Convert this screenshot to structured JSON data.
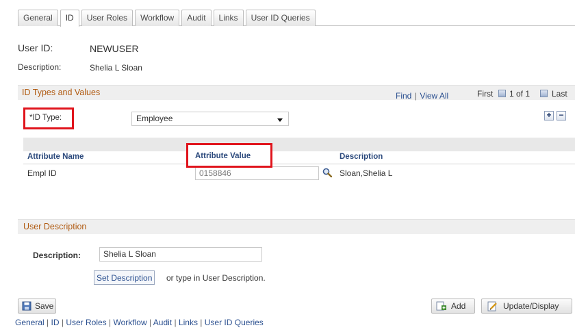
{
  "tabs": [
    {
      "label": "General"
    },
    {
      "label": "ID"
    },
    {
      "label": "User Roles"
    },
    {
      "label": "Workflow"
    },
    {
      "label": "Audit"
    },
    {
      "label": "Links"
    },
    {
      "label": "User ID Queries"
    }
  ],
  "header": {
    "user_id_label": "User ID:",
    "user_id_value": "NEWUSER",
    "description_label": "Description:",
    "description_value": "Shelia L Sloan"
  },
  "id_types": {
    "title": "ID Types and Values",
    "find_link": "Find",
    "separator": "|",
    "view_all_link": "View All",
    "first_label": "First",
    "range_text": "1 of 1",
    "last_label": "Last",
    "add_row": "+",
    "delete_row": "−",
    "id_type_label": "*ID Type:",
    "id_type_value": "Employee"
  },
  "attribute_grid": {
    "headers": {
      "name": "Attribute Name",
      "value": "Attribute Value",
      "description": "Description"
    },
    "rows": [
      {
        "name": "Empl ID",
        "value": "0158846",
        "description": "Sloan,Shelia L"
      }
    ]
  },
  "user_description": {
    "title": "User Description",
    "description_label": "Description:",
    "description_value": "Shelia L Sloan",
    "set_description_button": "Set Description",
    "hint": "or type in User Description."
  },
  "footer": {
    "save_button": "Save",
    "add_button": "Add",
    "update_button": "Update/Display"
  },
  "bottom_links": [
    "General",
    "|",
    "ID",
    "|",
    "User Roles",
    "|",
    "Workflow",
    "|",
    "Audit",
    "|",
    "Links",
    "|",
    "User ID Queries"
  ],
  "colors": {
    "highlight_box": "#e0141c",
    "section_title": "#b05a10",
    "link": "#2a4f8f"
  }
}
